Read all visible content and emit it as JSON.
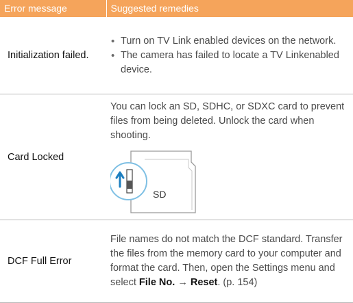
{
  "header": {
    "col1": "Error message",
    "col2": "Suggested remedies"
  },
  "rows": [
    {
      "error": "Initialization failed.",
      "bullets": [
        "Turn on TV Link enabled devices on the network.",
        "The camera has failed to locate a TV Linkenabled device."
      ]
    },
    {
      "error": "Card Locked",
      "remedy": "You can lock an SD, SDHC, or SDXC card to prevent files from being deleted. Unlock the card when shooting.",
      "card_label": "SD"
    },
    {
      "error": "DCF Full Error",
      "remedy_part1": "File names do not match the DCF standard. Transfer the files from the memory card to your computer and format the card. Then, open the Settings menu and select ",
      "menu_item": "File No.",
      "arrow": " → ",
      "menu_value": "Reset",
      "remedy_part2": ". (p. 154)"
    }
  ],
  "bullet_char": "•",
  "colors": {
    "header_bg": "#f5a45b",
    "divider": "#b8b8b8",
    "lock_arrow": "#1e7fc0"
  }
}
